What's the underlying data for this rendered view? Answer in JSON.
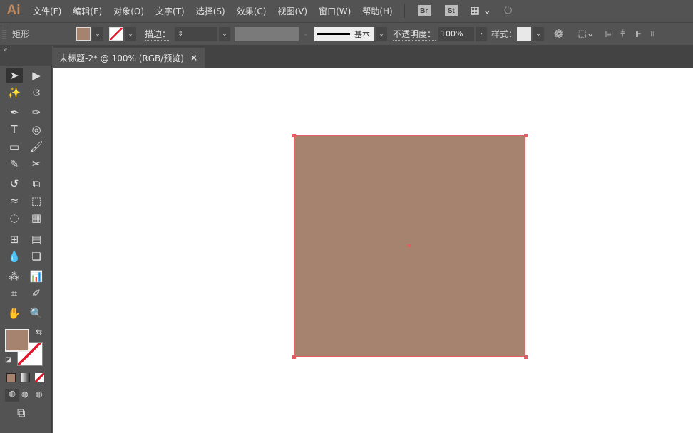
{
  "app": {
    "logo": "Ai"
  },
  "menu": [
    "文件(F)",
    "编辑(E)",
    "对象(O)",
    "文字(T)",
    "选择(S)",
    "效果(C)",
    "视图(V)",
    "窗口(W)",
    "帮助(H)"
  ],
  "appbar": {
    "bridge": "Br",
    "stock": "St"
  },
  "control": {
    "selection_type": "矩形",
    "fill_color": "#a6836f",
    "stroke_label": "描边：",
    "stroke_value": "",
    "brush_label": "基本",
    "opacity_label": "不透明度：",
    "opacity_value": "100%",
    "style_label": "样式："
  },
  "tab": {
    "title": "未标题-2* @ 100% (RGB/预览)",
    "close": "×"
  },
  "tools": [
    {
      "name": "selection-tool",
      "glyph": "➤"
    },
    {
      "name": "direct-selection-tool",
      "glyph": "▶"
    },
    {
      "name": "magic-wand-tool",
      "glyph": "✨"
    },
    {
      "name": "lasso-tool",
      "glyph": "ଓ"
    },
    {
      "name": "pen-tool",
      "glyph": "✒"
    },
    {
      "name": "curvature-tool",
      "glyph": "✑"
    },
    {
      "name": "type-tool",
      "glyph": "T"
    },
    {
      "name": "spiral-tool",
      "glyph": "◎"
    },
    {
      "name": "rectangle-tool",
      "glyph": "▭"
    },
    {
      "name": "paintbrush-tool",
      "glyph": "🖌"
    },
    {
      "name": "shaper-tool",
      "glyph": "✎"
    },
    {
      "name": "scissors-tool",
      "glyph": "✂"
    },
    {
      "name": "rotate-tool",
      "glyph": "↺"
    },
    {
      "name": "scale-tool",
      "glyph": "⧉"
    },
    {
      "name": "warp-tool",
      "glyph": "≈"
    },
    {
      "name": "free-transform-tool",
      "glyph": "⬚"
    },
    {
      "name": "shape-builder-tool",
      "glyph": "◌"
    },
    {
      "name": "perspective-grid-tool",
      "glyph": "▦"
    },
    {
      "name": "mesh-tool",
      "glyph": "⊞"
    },
    {
      "name": "gradient-tool",
      "glyph": "▤"
    },
    {
      "name": "eyedropper-tool",
      "glyph": "💧"
    },
    {
      "name": "blend-tool",
      "glyph": "❏"
    },
    {
      "name": "symbol-sprayer-tool",
      "glyph": "⁂"
    },
    {
      "name": "column-graph-tool",
      "glyph": "📊"
    },
    {
      "name": "artboard-tool",
      "glyph": "⌗"
    },
    {
      "name": "slice-tool",
      "glyph": "✐"
    },
    {
      "name": "hand-tool",
      "glyph": "✋"
    },
    {
      "name": "zoom-tool",
      "glyph": "🔍"
    }
  ],
  "colors": {
    "fill": "#a6836f",
    "stroke": "none",
    "selection": "#e55b62",
    "accent": "#c38a5e"
  }
}
